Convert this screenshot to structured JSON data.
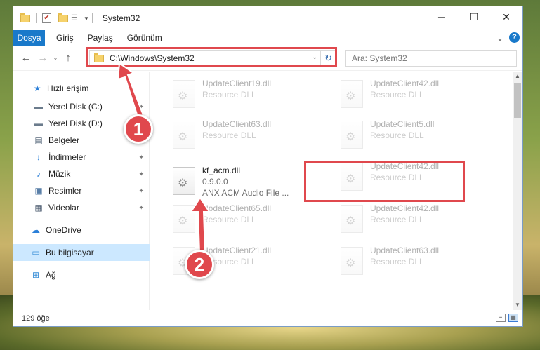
{
  "window": {
    "title": "System32",
    "minimize_label": "─",
    "maximize_label": "☐",
    "close_label": "✕"
  },
  "ribbon": {
    "tabs": [
      "Dosya",
      "Giriş",
      "Paylaş",
      "Görünüm"
    ],
    "expand_label": "⌄",
    "help_label": "?"
  },
  "nav": {
    "back": "←",
    "forward": "→",
    "recent": "⌄",
    "up": "↑",
    "address": "C:\\Windows\\System32",
    "address_dropdown": "⌄",
    "refresh": "↻",
    "search_placeholder": "Ara: System32"
  },
  "sidebar": {
    "items": [
      {
        "label": "Hızlı erişim",
        "icon": "star-icon",
        "glyph": "★",
        "color": "#2b7fd8",
        "pinned": false
      },
      {
        "label": "Yerel Disk (C:)",
        "icon": "drive-icon",
        "glyph": "▬",
        "color": "#6b7b8c",
        "pinned": true
      },
      {
        "label": "Yerel Disk (D:)",
        "icon": "drive-icon",
        "glyph": "▬",
        "color": "#6b7b8c",
        "pinned": true
      },
      {
        "label": "Belgeler",
        "icon": "documents-icon",
        "glyph": "▤",
        "color": "#5a6b7e",
        "pinned": true
      },
      {
        "label": "İndirmeler",
        "icon": "download-icon",
        "glyph": "↓",
        "color": "#2b7fd8",
        "pinned": true
      },
      {
        "label": "Müzik",
        "icon": "music-icon",
        "glyph": "♪",
        "color": "#2b7fd8",
        "pinned": true
      },
      {
        "label": "Resimler",
        "icon": "pictures-icon",
        "glyph": "▣",
        "color": "#5a7fa8",
        "pinned": true
      },
      {
        "label": "Videolar",
        "icon": "videos-icon",
        "glyph": "▦",
        "color": "#4a5a6e",
        "pinned": true
      },
      {
        "label": "OneDrive",
        "icon": "cloud-icon",
        "glyph": "☁",
        "color": "#2b7fd8",
        "pinned": false
      },
      {
        "label": "Bu bilgisayar",
        "icon": "computer-icon",
        "glyph": "▭",
        "color": "#3a8fd8",
        "pinned": false
      },
      {
        "label": "Ağ",
        "icon": "network-icon",
        "glyph": "⊞",
        "color": "#3a8fd8",
        "pinned": false
      }
    ],
    "pin_glyph": "📌"
  },
  "files": [
    {
      "name": "UpdateClient19.dll",
      "desc": "Resource DLL",
      "desc2": ""
    },
    {
      "name": "UpdateClient42.dll",
      "desc": "Resource DLL",
      "desc2": ""
    },
    {
      "name": "UpdateClient63.dll",
      "desc": "Resource DLL",
      "desc2": ""
    },
    {
      "name": "UpdateClient5.dll",
      "desc": "Resource DLL",
      "desc2": ""
    },
    {
      "name": "kf_acm.dll",
      "desc": "0.9.0.0",
      "desc2": "ANX ACM Audio File ..."
    },
    {
      "name": "UpdateClient42.dll",
      "desc": "Resource DLL",
      "desc2": ""
    },
    {
      "name": "UpdateClient65.dll",
      "desc": "Resource DLL",
      "desc2": ""
    },
    {
      "name": "UpdateClient42.dll",
      "desc": "Resource DLL",
      "desc2": ""
    },
    {
      "name": "UpdateClient21.dll",
      "desc": "Resource DLL",
      "desc2": ""
    },
    {
      "name": "UpdateClient63.dll",
      "desc": "Resource DLL",
      "desc2": ""
    }
  ],
  "status": {
    "count": "129 öğe"
  },
  "annotations": {
    "badge1": "1",
    "badge2": "2",
    "color": "#e0484d"
  }
}
